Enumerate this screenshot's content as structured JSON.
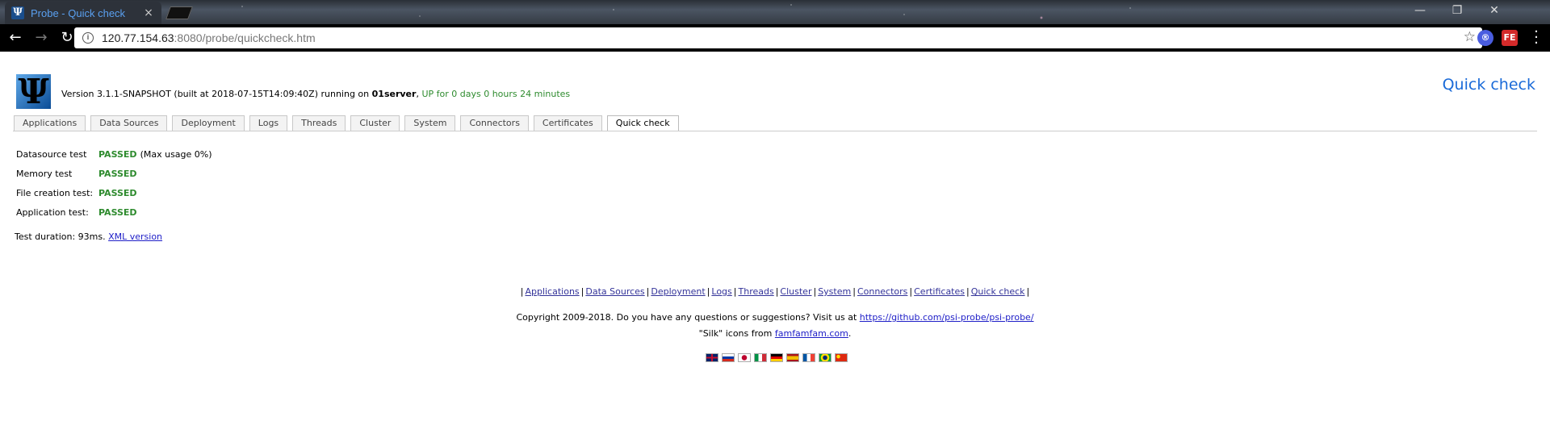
{
  "browser": {
    "tab_title": "Probe - Quick check",
    "tab_close": "×",
    "address_host": "120.77.154.63",
    "address_path": ":8080/probe/quickcheck.htm",
    "window_controls": [
      "—",
      "❐",
      "✕"
    ],
    "ext1_label": "®",
    "ext2_label": "FE"
  },
  "header": {
    "logo_glyph": "Ψ",
    "version_text": "Version 3.1.1-SNAPSHOT (built at 2018-07-15T14:09:40Z) running on ",
    "server_name": "01server",
    "uptime": "UP for 0 days 0 hours 24 minutes",
    "page_title": "Quick check"
  },
  "tabs": [
    {
      "label": "Applications"
    },
    {
      "label": "Data Sources"
    },
    {
      "label": "Deployment"
    },
    {
      "label": "Logs"
    },
    {
      "label": "Threads"
    },
    {
      "label": "Cluster"
    },
    {
      "label": "System"
    },
    {
      "label": "Connectors"
    },
    {
      "label": "Certificates"
    },
    {
      "label": "Quick check",
      "active": true
    }
  ],
  "results": [
    {
      "label": "Datasource test",
      "status": "PASSED",
      "note": "(Max usage 0%)"
    },
    {
      "label": "Memory test",
      "status": "PASSED",
      "note": ""
    },
    {
      "label": "File creation test:",
      "status": "PASSED",
      "note": ""
    },
    {
      "label": "Application test:",
      "status": "PASSED",
      "note": ""
    }
  ],
  "duration": {
    "text": "Test duration: 93ms.",
    "xml_link": "XML version"
  },
  "footer": {
    "nav": [
      "Applications",
      "Data Sources",
      "Deployment",
      "Logs",
      "Threads",
      "Cluster",
      "System",
      "Connectors",
      "Certificates",
      "Quick check"
    ],
    "copyright_text": "Copyright 2009-2018. Do you have any questions or suggestions? Visit us at ",
    "copyright_link": "https://github.com/psi-probe/psi-probe/",
    "silk_prefix": "\"Silk\" icons from ",
    "silk_link": "famfamfam.com",
    "silk_suffix": ".",
    "flags": [
      "uk",
      "ru",
      "jp",
      "it",
      "de",
      "es",
      "fr",
      "br",
      "cn"
    ]
  },
  "colors": {
    "passed": "#2e8b2e",
    "title_blue": "#1a6ad8",
    "link": "#2020c8"
  }
}
